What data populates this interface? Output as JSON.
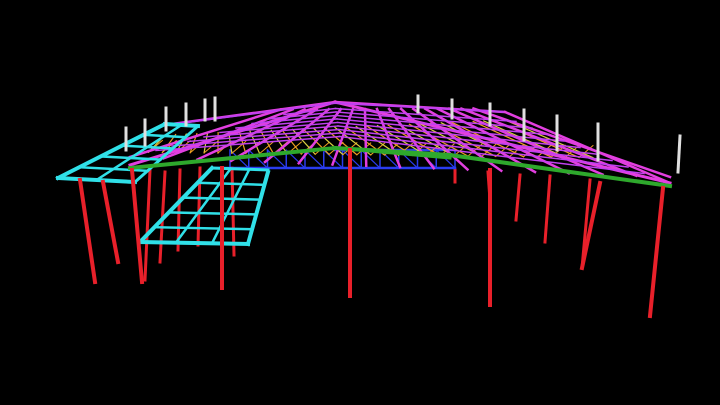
{
  "scene": {
    "subject": "steel-frame-structure-3d-render",
    "background": "#000000",
    "colors": {
      "column": "#e8202a",
      "column_dark": "#9a1418",
      "roof_rafter": "#e23fe0",
      "roof_purlin": "#c040f0",
      "ridge_beam": "#2ea82c",
      "eave_beam": "#2ea82c",
      "web_member": "#f0a020",
      "web_member_alt": "#d8d040",
      "bracing": "#2a3cf0",
      "platform": "#30e0e8",
      "post_top": "#e0e0e0"
    }
  }
}
